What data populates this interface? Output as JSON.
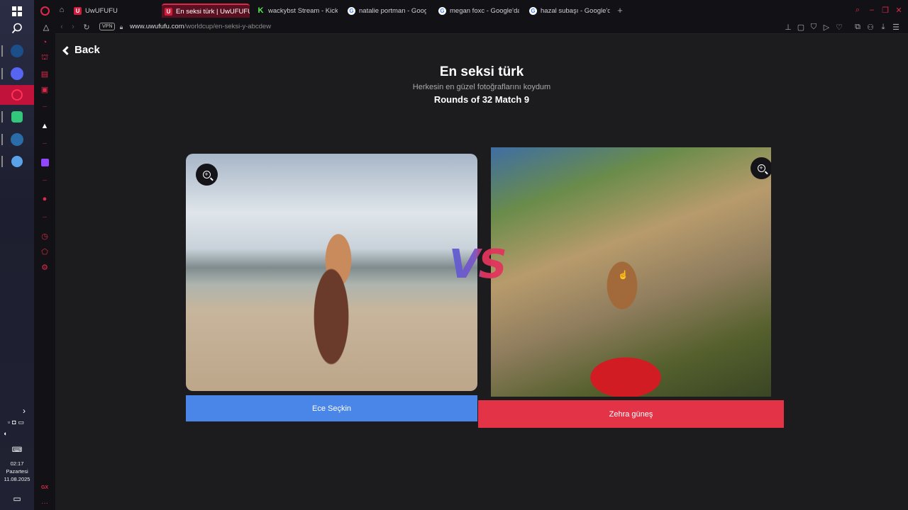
{
  "taskbar": {
    "time": "02:17",
    "day": "Pazartesi",
    "date": "11.08.2025"
  },
  "opera_sidebar": {
    "bottom_label": "GX"
  },
  "tabs": [
    {
      "label": "UwUFUFU",
      "favicon": "U"
    },
    {
      "label": "En seksi türk | UwUFUFU",
      "favicon": "U",
      "active": true
    },
    {
      "label": "wackybst Stream - Kick (",
      "favicon": "K"
    },
    {
      "label": "natalie portman - Google",
      "favicon": "G"
    },
    {
      "label": "megan foxc - Google'da A",
      "favicon": "G"
    },
    {
      "label": "hazal subaşı - Google'da",
      "favicon": "G"
    }
  ],
  "addressbar": {
    "vpn_label": "VPN",
    "url_host": "www.uwufufu.com",
    "url_path": "/worldcup/en-seksi-y-abcdew"
  },
  "page": {
    "back_label": "Back",
    "title": "En seksi türk",
    "subtitle": "Herkesin en güzel fotoğraflarını koydum",
    "round_info": "Rounds of 32 Match 9",
    "vs_label": "VS",
    "left_choice": "Ece Seçkin",
    "right_choice": "Zehra güneş"
  },
  "colors": {
    "accent": "#e0294a",
    "left_button": "#4a86e8",
    "right_button": "#e33447",
    "background": "#1c1c1f"
  }
}
